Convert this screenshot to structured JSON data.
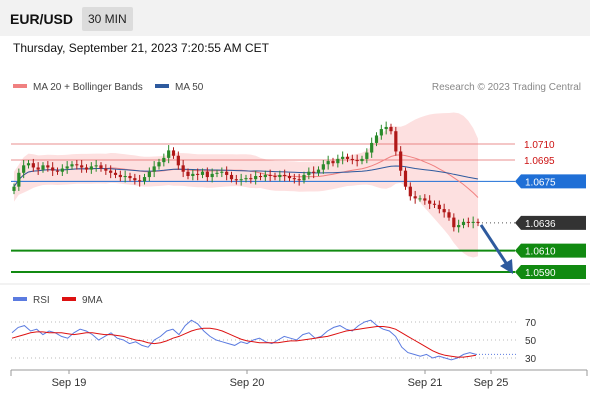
{
  "header": {
    "symbol": "EUR/USD",
    "timeframe": "30 MIN",
    "datetime": "Thursday, September 21, 2023 7:20:55 AM CET"
  },
  "legend": {
    "ma20_label": "MA 20 + Bollinger Bands",
    "ma50_label": "MA 50",
    "credit": "Research © 2023 Trading Central",
    "rsi_label": "RSI",
    "rsi_ma_label": "9MA"
  },
  "colors": {
    "ma20": "#f08080",
    "ma50": "#2e5a9e",
    "band_fill": "#fde0e0",
    "resistance": "#e06060",
    "pivot": "#1f6fd6",
    "support": "#118a11",
    "current": "#333333",
    "arrow": "#2e5a9e",
    "rsi": "#5b7be0",
    "rsi_ma": "#dd1111"
  },
  "chart_data": [
    {
      "type": "candlestick",
      "title": "EUR/USD",
      "timeframe": "30 MIN",
      "ylim": [
        1.0565,
        1.0745
      ],
      "x_ticks": [
        "Sep 19",
        "Sep 20",
        "Sep 21",
        "Sep 25"
      ],
      "close": [
        1.067,
        1.0683,
        1.069,
        1.0692,
        1.0688,
        1.0686,
        1.069,
        1.0688,
        1.0685,
        1.0684,
        1.0687,
        1.0689,
        1.0691,
        1.069,
        1.0688,
        1.0686,
        1.0689,
        1.069,
        1.0687,
        1.0685,
        1.0683,
        1.0681,
        1.0679,
        1.068,
        1.0678,
        1.0676,
        1.0675,
        1.0679,
        1.0684,
        1.0689,
        1.0693,
        1.0697,
        1.0704,
        1.0699,
        1.069,
        1.0684,
        1.068,
        1.0682,
        1.0681,
        1.0684,
        1.0679,
        1.0682,
        1.0683,
        1.0684,
        1.0681,
        1.0677,
        1.0676,
        1.0677,
        1.0678,
        1.0677,
        1.068,
        1.0679,
        1.0681,
        1.068,
        1.0679,
        1.0681,
        1.068,
        1.0678,
        1.0677,
        1.0676,
        1.0681,
        1.0684,
        1.0683,
        1.0686,
        1.0691,
        1.0694,
        1.0692,
        1.0696,
        1.0698,
        1.0696,
        1.0695,
        1.0694,
        1.0696,
        1.0702,
        1.0711,
        1.0718,
        1.0724,
        1.0726,
        1.0722,
        1.0703,
        1.0685,
        1.067,
        1.0661,
        1.0659,
        1.0659,
        1.0657,
        1.0654,
        1.0653,
        1.0649,
        1.0646,
        1.0641,
        1.0632,
        1.0634,
        1.0637,
        1.0636,
        1.0637,
        1.0636
      ],
      "current_price": 1.0636,
      "levels": [
        {
          "value": "1.0710",
          "kind": "resistance"
        },
        {
          "value": "1.0695",
          "kind": "resistance"
        },
        {
          "value": "1.0675",
          "kind": "pivot"
        },
        {
          "value": "1.0636",
          "kind": "current"
        },
        {
          "value": "1.0610",
          "kind": "support"
        },
        {
          "value": "1.0590",
          "kind": "support"
        }
      ],
      "forecast_direction": "down",
      "series": [
        {
          "name": "MA 20 + Bollinger Bands"
        },
        {
          "name": "MA 50"
        }
      ],
      "credit": "Research © 2023 Trading Central"
    },
    {
      "type": "line",
      "indicator": "RSI",
      "ylim": [
        20,
        80
      ],
      "y_ticks": [
        "70",
        "50",
        "30"
      ],
      "rsi": [
        58,
        64,
        66,
        60,
        62,
        56,
        60,
        58,
        54,
        52,
        58,
        62,
        60,
        56,
        50,
        54,
        58,
        52,
        50,
        46,
        48,
        44,
        42,
        50,
        54,
        60,
        62,
        56,
        66,
        72,
        68,
        60,
        54,
        50,
        48,
        46,
        44,
        48,
        46,
        50,
        52,
        48,
        46,
        50,
        54,
        52,
        50,
        56,
        58,
        52,
        54,
        60,
        64,
        66,
        62,
        60,
        66,
        70,
        72,
        66,
        62,
        60,
        54,
        42,
        36,
        34,
        32,
        34,
        30,
        32,
        30,
        28,
        30,
        34,
        36,
        34
      ],
      "rsi_ma": [
        52,
        54,
        56,
        58,
        59,
        59,
        58,
        58,
        58,
        57,
        56,
        57,
        58,
        58,
        57,
        56,
        56,
        55,
        54,
        52,
        50,
        49,
        47,
        46,
        47,
        49,
        52,
        54,
        57,
        60,
        62,
        63,
        63,
        62,
        60,
        57,
        54,
        51,
        49,
        48,
        47,
        47,
        47,
        47,
        48,
        49,
        49,
        50,
        51,
        52,
        53,
        54,
        56,
        58,
        60,
        61,
        62,
        63,
        64,
        65,
        65,
        64,
        62,
        58,
        54,
        50,
        46,
        42,
        38,
        35,
        33,
        32,
        31,
        31,
        32,
        33
      ],
      "series": [
        {
          "name": "RSI"
        },
        {
          "name": "9MA"
        }
      ]
    }
  ]
}
